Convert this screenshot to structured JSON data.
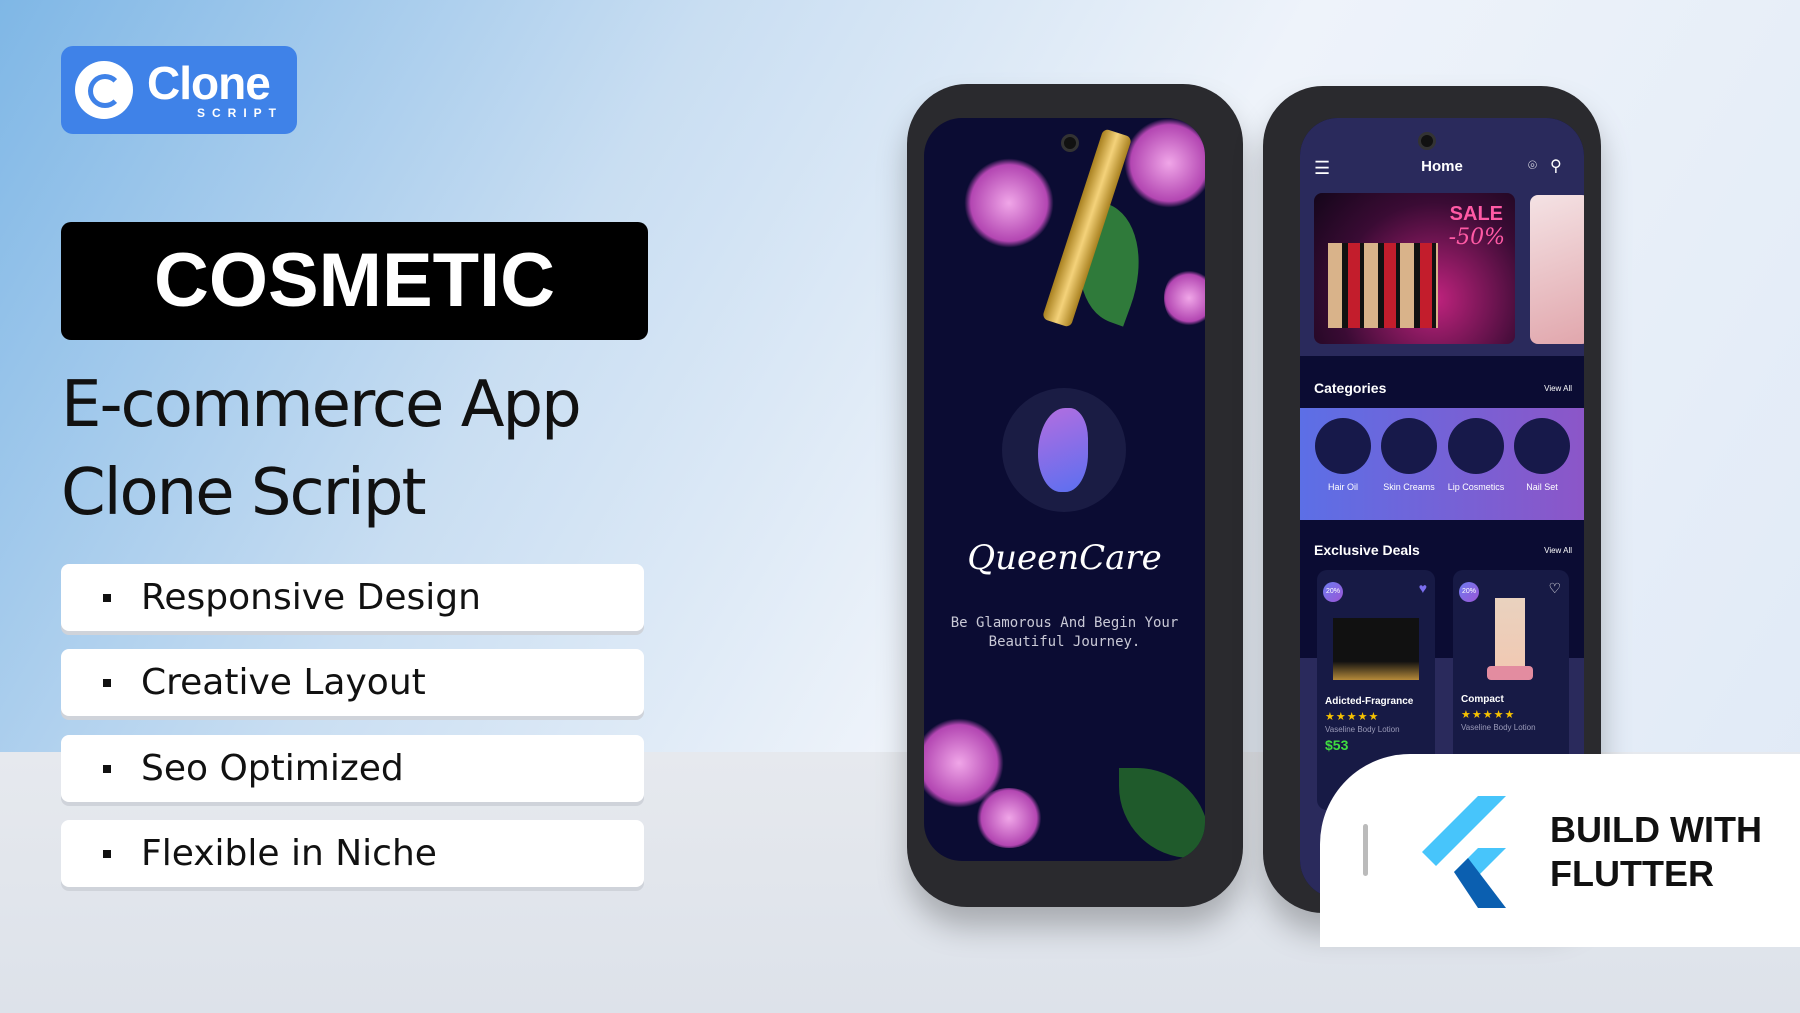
{
  "logo": {
    "name": "Clone",
    "tagline": "SCRIPT"
  },
  "hero": {
    "badge": "COSMETIC",
    "line1": "E-commerce App",
    "line2": "Clone Script"
  },
  "features": [
    "Responsive Design",
    "Creative Layout",
    "Seo Optimized",
    "Flexible in Niche"
  ],
  "splash": {
    "brand": "QueenCare",
    "tagline1": "Be Glamorous And Begin Your",
    "tagline2": "Beautiful Journey."
  },
  "home": {
    "title": "Home",
    "banner": {
      "sale": "SALE",
      "discount": "-50%"
    },
    "categories_title": "Categories",
    "view_all": "View All",
    "categories": [
      "Hair Oil",
      "Skin Creams",
      "Lip Cosmetics",
      "Nail Set"
    ],
    "deals_title": "Exclusive Deals",
    "deals": [
      {
        "badge": "20%",
        "name": "Adicted-Fragrance",
        "rating": "★★★★★",
        "desc": "Vaseline Body Lotion",
        "price": "$53"
      },
      {
        "badge": "20%",
        "name": "Compact",
        "rating": "★★★★★",
        "desc": "Vaseline Body Lotion"
      }
    ]
  },
  "flutter": {
    "line1": "BUILD WITH",
    "line2": "FLUTTER"
  },
  "colors": {
    "logo_bg": "#3f82e8",
    "screen_bg": "#0b0c33",
    "accent_purple": "#8a5fd8",
    "flutter_light": "#47c5fb",
    "flutter_dark": "#0b5fb0",
    "price_green": "#3fdc3f"
  }
}
